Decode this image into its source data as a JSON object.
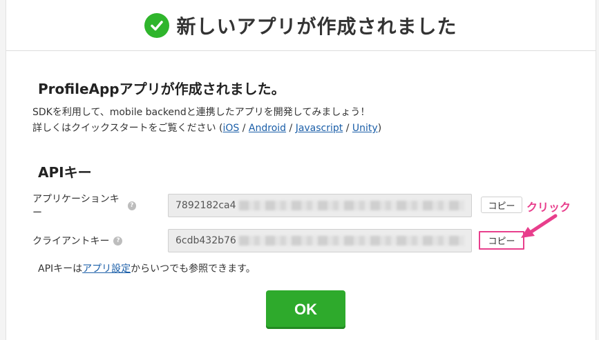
{
  "header": {
    "title": "新しいアプリが作成されました",
    "icon": "check-circle-icon",
    "icon_color": "#2fb52c"
  },
  "app": {
    "title": "ProfileAppアプリが作成されました。",
    "line1": "SDKを利用して、mobile backendと連携したアプリを開発してみましょう！",
    "line2_prefix": "詳しくはクイックスタートをご覧ください (",
    "links": [
      "iOS",
      "Android",
      "Javascript",
      "Unity"
    ],
    "separator": " / ",
    "line2_suffix": ")"
  },
  "api": {
    "heading": "APIキー",
    "application_key": {
      "label": "アプリケーションキー",
      "value": "7892182ca4",
      "copy_label": "コピー"
    },
    "client_key": {
      "label": "クライアントキー",
      "value": "6cdb432b76",
      "copy_label": "コピー"
    },
    "help_glyph": "?",
    "footnote_prefix": "APIキーは",
    "footnote_link": "アプリ設定",
    "footnote_suffix": "からいつでも参照できます。"
  },
  "annotation": {
    "label": "クリック",
    "color": "#e83e8c"
  },
  "ok_label": "OK",
  "colors": {
    "ok_button": "#2eaa2c",
    "link": "#1a5ea8"
  }
}
